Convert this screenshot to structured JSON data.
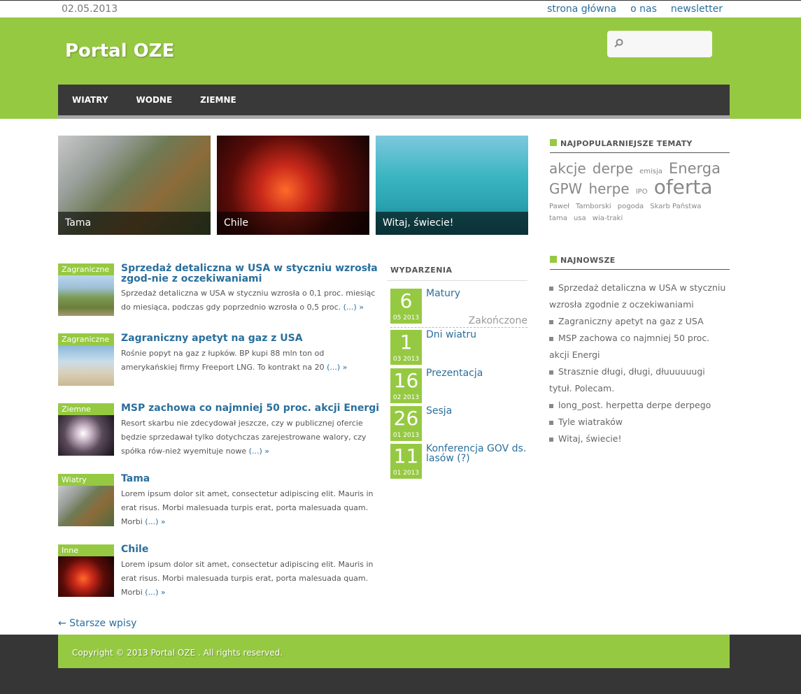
{
  "topbar": {
    "date": "02.05.2013",
    "links": [
      "strona główna",
      "o nas",
      "newsletter"
    ]
  },
  "header": {
    "site_title": "Portal OZE",
    "search_placeholder": "",
    "nav": [
      "WIATRY",
      "WODNE",
      "ZIEMNE"
    ]
  },
  "featured": [
    {
      "caption": "Tama",
      "image": "dam"
    },
    {
      "caption": "Chile",
      "image": "volcano-lightning"
    },
    {
      "caption": "Witaj, świecie!",
      "image": "tropical-resort"
    }
  ],
  "posts": [
    {
      "category": "Zagraniczne",
      "title": "Sprzedaż detaliczna w USA w styczniu wzrosła zgod-nie z oczekiwaniami",
      "excerpt": "Sprzedaż detaliczna w USA w styczniu wzrosła o 0,1 proc. miesiąc do miesiąca, podczas gdy poprzednio wzrosła o 0,5 proc.",
      "more": "(...) »"
    },
    {
      "category": "Zagraniczne",
      "title": "Zagraniczny apetyt na gaz z USA",
      "excerpt": "Rośnie popyt na gaz z łupków. BP kupi 88 mln ton od amerykańskiej firmy Freeport LNG. To kontrakt na 20",
      "more": "(...) »"
    },
    {
      "category": "Ziemne",
      "title": "MSP zachowa co najmniej 50 proc. akcji Energi",
      "excerpt": "Resort skarbu nie zdecydował jeszcze, czy w publicznej ofercie będzie sprzedawał tylko dotychczas zarejestrowane walory, czy spółka rów-nież wyemituje nowe",
      "more": "(...) »"
    },
    {
      "category": "Wiatry",
      "title": "Tama",
      "excerpt": "Lorem ipsum dolor sit amet, consectetur adipiscing elit. Mauris in erat risus. Morbi malesuada turpis erat, porta malesuada quam. Morbi",
      "more": "(...) »"
    },
    {
      "category": "Inne",
      "title": "Chile",
      "excerpt": "Lorem ipsum dolor sit amet, consectetur adipiscing elit. Mauris in erat risus. Morbi malesuada turpis erat, porta malesuada quam. Morbi",
      "more": "(...) »"
    }
  ],
  "events": {
    "title": "WYDARZENIA",
    "items": [
      {
        "day": "6",
        "monthyear": "05 2013",
        "name": "Matury",
        "status": "Zakończone"
      },
      {
        "day": "1",
        "monthyear": "03 2013",
        "name": "Dni wiatru"
      },
      {
        "day": "16",
        "monthyear": "02 2013",
        "name": "Prezentacja"
      },
      {
        "day": "26",
        "monthyear": "01 2013",
        "name": "Sesja"
      },
      {
        "day": "11",
        "monthyear": "01 2013",
        "name": "Konferencja GOV ds. lasów (?)"
      }
    ]
  },
  "sidebar": {
    "popular_title": "NAJPOPULARNIEJSZE TEMATY",
    "tags": [
      {
        "label": "akcje",
        "size": 20
      },
      {
        "label": "derpe",
        "size": 20
      },
      {
        "label": "emisja",
        "size": 10
      },
      {
        "label": "Energa",
        "size": 21
      },
      {
        "label": "GPW",
        "size": 20
      },
      {
        "label": "herpe",
        "size": 20
      },
      {
        "label": "IPO",
        "size": 10
      },
      {
        "label": "oferta",
        "size": 28
      },
      {
        "label": "Paweł",
        "size": 10
      },
      {
        "label": "Tamborski",
        "size": 10
      },
      {
        "label": "pogoda",
        "size": 10
      },
      {
        "label": "Skarb Państwa",
        "size": 10
      },
      {
        "label": "tama",
        "size": 10
      },
      {
        "label": "usa",
        "size": 10
      },
      {
        "label": "wia-traki",
        "size": 10
      }
    ],
    "recent_title": "NAJNOWSZE",
    "recent": [
      "Sprzedaż detaliczna w USA w styczniu wzrosła zgodnie z oczekiwaniami",
      "Zagraniczny apetyt na gaz z USA",
      "MSP zachowa co najmniej 50 proc. akcji Energi",
      "Strasznie długi, długi, dłuuuuuugi tytuł. Polecam.",
      "long_post. herpetta derpe derpego",
      "Tyle wiatraków",
      "Witaj, świecie!"
    ]
  },
  "older_link": "← Starsze wpisy",
  "footer": {
    "copyright": "Copyright © 2013 Portal OZE . All rights reserved."
  }
}
